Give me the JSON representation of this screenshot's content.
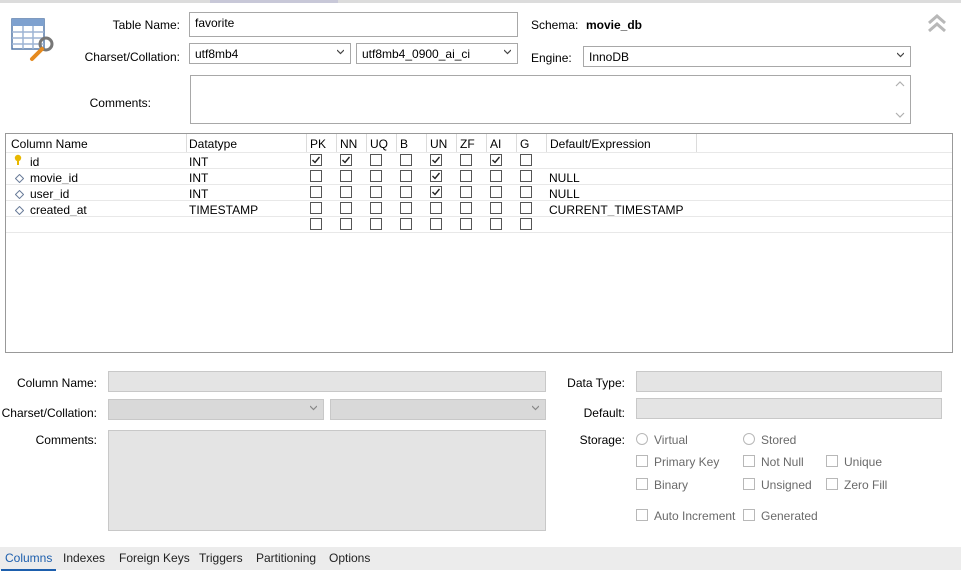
{
  "table": {
    "name_label": "Table Name:",
    "name_value": "favorite",
    "schema_label": "Schema:",
    "schema_value": "movie_db",
    "charset_label": "Charset/Collation:",
    "charset_value": "utf8mb4",
    "collation_value": "utf8mb4_0900_ai_ci",
    "engine_label": "Engine:",
    "engine_value": "InnoDB",
    "comments_label": "Comments:",
    "comments_value": ""
  },
  "grid": {
    "headers": {
      "column_name": "Column Name",
      "datatype": "Datatype",
      "pk": "PK",
      "nn": "NN",
      "uq": "UQ",
      "b": "B",
      "un": "UN",
      "zf": "ZF",
      "ai": "AI",
      "g": "G",
      "default": "Default/Expression"
    },
    "rows": [
      {
        "name": "id",
        "type": "INT",
        "default": "",
        "flags": {
          "PK": true,
          "NN": true,
          "UQ": false,
          "B": false,
          "UN": true,
          "ZF": false,
          "AI": true,
          "G": false
        },
        "icon": "primary-key-icon"
      },
      {
        "name": "movie_id",
        "type": "INT",
        "default": "NULL",
        "flags": {
          "PK": false,
          "NN": false,
          "UQ": false,
          "B": false,
          "UN": true,
          "ZF": false,
          "AI": false,
          "G": false
        },
        "icon": "column-diamond-icon"
      },
      {
        "name": "user_id",
        "type": "INT",
        "default": "NULL",
        "flags": {
          "PK": false,
          "NN": false,
          "UQ": false,
          "B": false,
          "UN": true,
          "ZF": false,
          "AI": false,
          "G": false
        },
        "icon": "column-diamond-icon"
      },
      {
        "name": "created_at",
        "type": "TIMESTAMP",
        "default": "CURRENT_TIMESTAMP",
        "flags": {
          "PK": false,
          "NN": false,
          "UQ": false,
          "B": false,
          "UN": false,
          "ZF": false,
          "AI": false,
          "G": false
        },
        "icon": "column-diamond-icon"
      },
      {
        "name": "",
        "type": "",
        "default": "",
        "flags": {
          "PK": false,
          "NN": false,
          "UQ": false,
          "B": false,
          "UN": false,
          "ZF": false,
          "AI": false,
          "G": false
        },
        "icon": ""
      }
    ]
  },
  "details": {
    "column_name_label": "Column Name:",
    "charset_label": "Charset/Collation:",
    "comments_label": "Comments:",
    "data_type_label": "Data Type:",
    "default_label": "Default:",
    "storage_label": "Storage:",
    "virtual_label": "Virtual",
    "stored_label": "Stored",
    "primary_key_label": "Primary Key",
    "not_null_label": "Not Null",
    "unique_label": "Unique",
    "binary_label": "Binary",
    "unsigned_label": "Unsigned",
    "zero_fill_label": "Zero Fill",
    "auto_increment_label": "Auto Increment",
    "generated_label": "Generated"
  },
  "tabs": [
    "Columns",
    "Indexes",
    "Foreign Keys",
    "Triggers",
    "Partitioning",
    "Options"
  ],
  "active_tab": "Columns",
  "colors": {
    "accent": "#1d5fad",
    "key_icon": "#e8b800",
    "diamond_icon": "#6b7d9a"
  }
}
